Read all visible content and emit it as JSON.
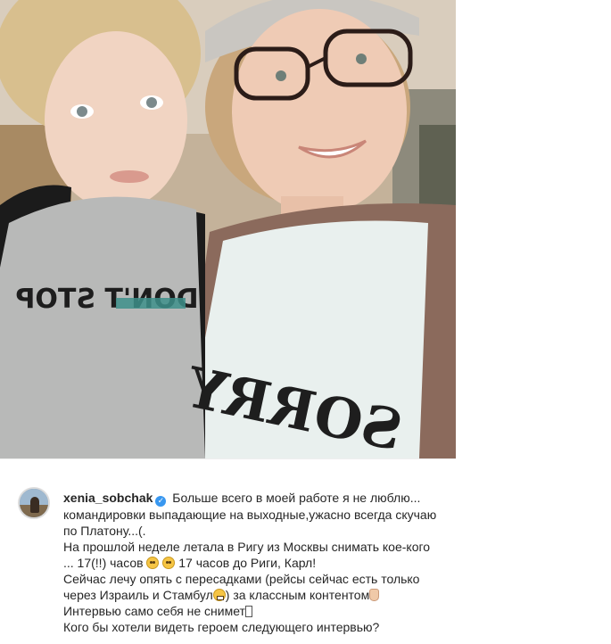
{
  "post": {
    "username": "xenia_sobchak",
    "verified_icon": "verified-badge-icon",
    "caption_lines": [
      " Больше всего в моей работе я не люблю...",
      "командировки выпадающие на выходные,ужасно всегда скучаю",
      "по Платону...(.",
      "На прошлой неделе летала в Ригу из Москвы снимать кое-кого",
      "... 17(!!) часов ",
      " 17 часов до Риги, Карл!",
      "Сейчас лечу опять с пересадками (рейсы сейчас есть только",
      "через Израиль и Стамбул",
      ") за классным контентом",
      "Интервью само себя не снимет",
      "Кого бы хотели видеть героем следующего интервью?"
    ],
    "photo": {
      "shirt_left_text": "DON'T STOP",
      "shirt_right_text": "SORRY"
    }
  }
}
